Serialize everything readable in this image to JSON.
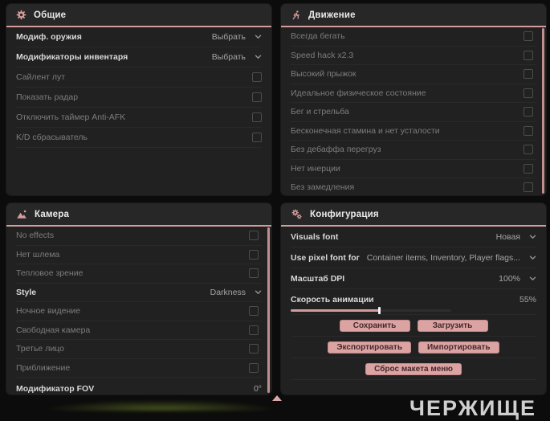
{
  "accent_color": "#d49c9c",
  "button_color": "#dca3a3",
  "button_text_color": "#45282b",
  "watermark": "ЧЕРЖИЩЕ",
  "panels": {
    "general": {
      "title": "Общие",
      "icon": "gear-icon",
      "rows": [
        {
          "label": "Модиф. оружия",
          "type": "dropdown",
          "value": "Выбрать",
          "emphasis": true
        },
        {
          "label": "Модификаторы инвентаря",
          "type": "dropdown",
          "value": "Выбрать",
          "emphasis": true
        },
        {
          "label": "Сайлент лут",
          "type": "checkbox",
          "checked": false
        },
        {
          "label": "Показать радар",
          "type": "checkbox",
          "checked": false
        },
        {
          "label": "Отключить таймер Anti-AFK",
          "type": "checkbox",
          "checked": false
        },
        {
          "label": "K/D сбрасыватель",
          "type": "checkbox",
          "checked": false
        }
      ]
    },
    "movement": {
      "title": "Движение",
      "icon": "runner-icon",
      "scrollbar": true,
      "rows": [
        {
          "label": "Всегда бегать",
          "type": "checkbox",
          "checked": false
        },
        {
          "label": "Speed hack x2.3",
          "type": "checkbox",
          "checked": false
        },
        {
          "label": "Высокий прыжок",
          "type": "checkbox",
          "checked": false
        },
        {
          "label": "Идеальное физическое состояние",
          "type": "checkbox",
          "checked": false
        },
        {
          "label": "Бег и стрельба",
          "type": "checkbox",
          "checked": false
        },
        {
          "label": "Бесконечная стамина и нет усталости",
          "type": "checkbox",
          "checked": false
        },
        {
          "label": "Без дебаффа перегруз",
          "type": "checkbox",
          "checked": false
        },
        {
          "label": "Нет инерции",
          "type": "checkbox",
          "checked": false
        },
        {
          "label": "Без замедления",
          "type": "checkbox",
          "checked": false
        }
      ]
    },
    "camera": {
      "title": "Камера",
      "icon": "image-icon",
      "scrollbar": true,
      "rows": [
        {
          "label": "No effects",
          "type": "checkbox",
          "checked": false
        },
        {
          "label": "Нет шлема",
          "type": "checkbox",
          "checked": false
        },
        {
          "label": "Тепловое зрение",
          "type": "checkbox",
          "checked": false
        },
        {
          "label": "Style",
          "type": "dropdown",
          "value": "Darkness",
          "emphasis": true
        },
        {
          "label": "Ночное видение",
          "type": "checkbox",
          "checked": false
        },
        {
          "label": "Свободная камера",
          "type": "checkbox",
          "checked": false
        },
        {
          "label": "Третье лицо",
          "type": "checkbox",
          "checked": false
        },
        {
          "label": "Приближение",
          "type": "checkbox",
          "checked": false
        },
        {
          "label": "Модификатор FOV",
          "type": "slider",
          "value": "0°",
          "percent": 0,
          "emphasis": true
        }
      ]
    },
    "config": {
      "title": "Конфигурация",
      "icon": "gears-icon",
      "rows": [
        {
          "label": "Visuals font",
          "type": "dropdown",
          "value": "Новая",
          "emphasis": true
        },
        {
          "label": "Use pixel font for",
          "type": "dropdown",
          "value": "Container items, Inventory, Player flags...",
          "emphasis": true
        },
        {
          "label": "Масштаб DPI",
          "type": "dropdown",
          "value": "100%",
          "emphasis": true
        },
        {
          "label": "Скорость анимации",
          "type": "slider",
          "value": "55%",
          "percent": 55,
          "emphasis": true
        }
      ],
      "buttons": [
        {
          "name": "save",
          "label": "Сохранить"
        },
        {
          "name": "load",
          "label": "Загрузить"
        },
        {
          "name": "export",
          "label": "Экспортировать"
        },
        {
          "name": "import",
          "label": "Импортировать"
        },
        {
          "name": "reset-menu-layout",
          "label": "Сброс макета меню"
        }
      ]
    }
  }
}
